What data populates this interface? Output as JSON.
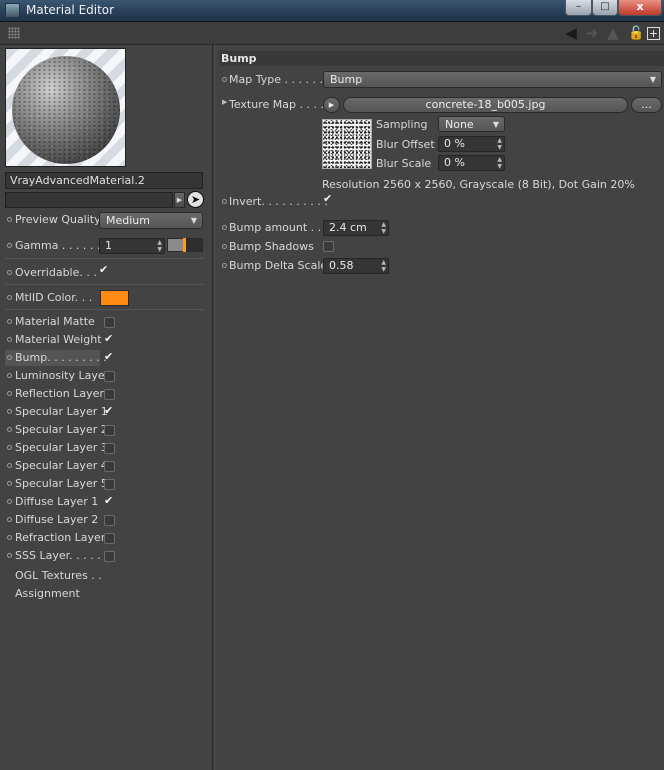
{
  "window": {
    "title": "Material Editor"
  },
  "window_controls": {
    "minimize": "–",
    "maximize": "□",
    "close": "x"
  },
  "toolbar": {
    "icons": [
      "grip-icon",
      "back-arrow-icon",
      "forward-arrow-icon",
      "up-arrow-icon",
      "lock-icon",
      "new-window-icon"
    ]
  },
  "material": {
    "name": "VrayAdvancedMaterial.2"
  },
  "left": {
    "preview_quality": {
      "label": "Preview Quality",
      "value": "Medium"
    },
    "gamma": {
      "label": "Gamma . . . . . .",
      "value": "1"
    },
    "overridable": {
      "label": "Overridable. . .",
      "checked": true
    },
    "mtlid_color": {
      "label": "MtlID Color. . .",
      "color": "#ff8a14"
    },
    "layers": [
      {
        "label": "Material Matte",
        "checked": false
      },
      {
        "label": "Material Weight",
        "checked": true
      },
      {
        "label": "Bump. . . . . . . . .",
        "checked": true,
        "selected": true
      },
      {
        "label": "Luminosity Layer",
        "checked": false
      },
      {
        "label": "Reflection Layer",
        "checked": false
      },
      {
        "label": "Specular Layer 1",
        "checked": true
      },
      {
        "label": "Specular Layer 2",
        "checked": false
      },
      {
        "label": "Specular Layer 3",
        "checked": false
      },
      {
        "label": "Specular Layer 4",
        "checked": false
      },
      {
        "label": "Specular Layer 5",
        "checked": false
      },
      {
        "label": "Diffuse Layer 1",
        "checked": true
      },
      {
        "label": "Diffuse Layer 2",
        "checked": false
      },
      {
        "label": "Refraction Layer",
        "checked": false
      },
      {
        "label": "SSS Layer. . . . . .",
        "checked": false
      }
    ],
    "ogl_textures": "OGL Textures  . .",
    "assignment": "Assignment"
  },
  "bump": {
    "header": "Bump",
    "map_type": {
      "label": "Map Type  . . . . . .",
      "value": "Bump"
    },
    "texture_map": {
      "label": "Texture Map . . . .",
      "file": "concrete-18_b005.jpg",
      "more": "..."
    },
    "sampling": {
      "label": "Sampling",
      "value": "None"
    },
    "blur_offset": {
      "label": "Blur Offset",
      "value": "0 %"
    },
    "blur_scale": {
      "label": "Blur Scale",
      "value": "0 %"
    },
    "resolution": "Resolution 2560 x 2560, Grayscale (8 Bit), Dot Gain 20%",
    "invert": {
      "label": "Invert. . . . . . . . . .",
      "checked": true
    },
    "bump_amount": {
      "label": "Bump amount  . .",
      "value": "2.4 cm"
    },
    "bump_shadows": {
      "label": "Bump Shadows",
      "checked": false
    },
    "bump_delta_scale": {
      "label": "Bump Delta Scale",
      "value": "0.58"
    }
  }
}
